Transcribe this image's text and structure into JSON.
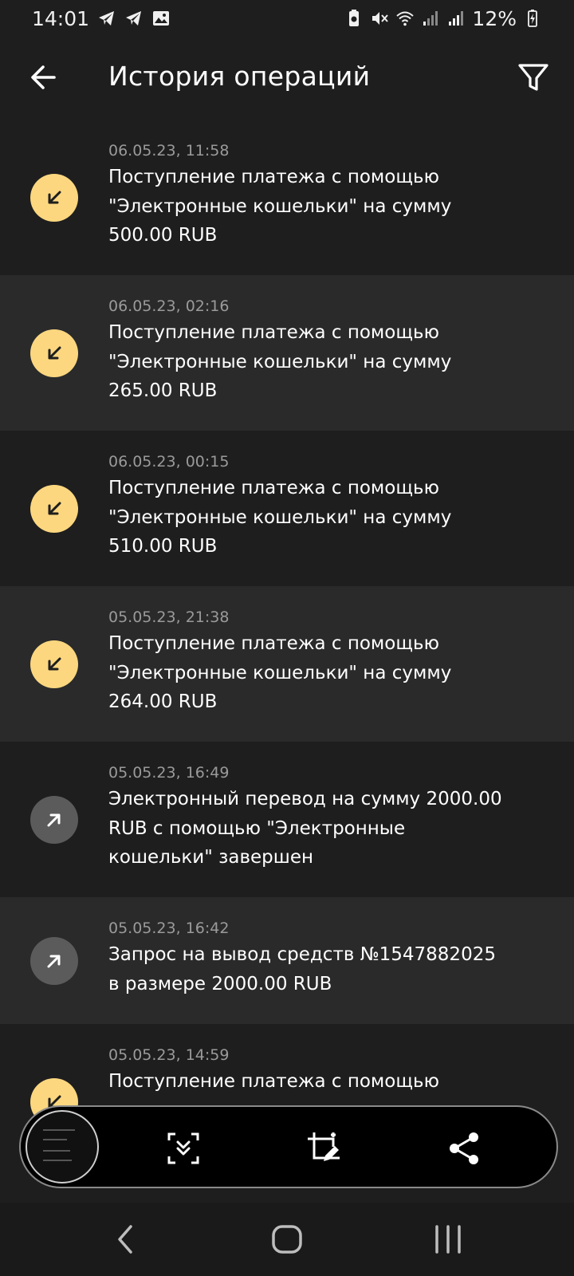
{
  "status_bar": {
    "time": "14:01",
    "battery": "12%",
    "left_icons": [
      "telegram-icon",
      "telegram-icon",
      "gallery-icon"
    ],
    "right_icons": [
      "battery-saver-icon",
      "mute-icon",
      "wifi-icon",
      "signal-icon",
      "signal-icon",
      "battery-charging-icon"
    ]
  },
  "header": {
    "title": "История операций",
    "back_icon": "arrow-left-icon",
    "filter_icon": "filter-icon"
  },
  "colors": {
    "background": "#1e1e1e",
    "row_alt": "#2a2a2a",
    "incoming": "#fcd77f",
    "outgoing": "#5b5b5b",
    "date_text": "#9a9a9a"
  },
  "operations": [
    {
      "date": "06.05.23, 11:58",
      "text": "Поступление платежа с помощью \"Электронные кошельки\" на сумму 500.00 RUB",
      "direction": "incoming"
    },
    {
      "date": "06.05.23, 02:16",
      "text": "Поступление платежа с помощью \"Электронные кошельки\" на сумму 265.00 RUB",
      "direction": "incoming"
    },
    {
      "date": "06.05.23, 00:15",
      "text": "Поступление платежа с помощью \"Электронные кошельки\" на сумму 510.00 RUB",
      "direction": "incoming"
    },
    {
      "date": "05.05.23, 21:38",
      "text": "Поступление платежа с помощью \"Электронные кошельки\" на сумму 264.00 RUB",
      "direction": "incoming"
    },
    {
      "date": "05.05.23, 16:49",
      "text": "Электронный перевод на сумму 2000.00 RUB с помощью \"Электронные кошельки\" завершен",
      "direction": "outgoing"
    },
    {
      "date": "05.05.23, 16:42",
      "text": "Запрос на вывод средств №1547882025 в размере 2000.00 RUB",
      "direction": "outgoing"
    },
    {
      "date": "05.05.23, 14:59",
      "text": "Поступление платежа с помощью",
      "direction": "incoming"
    }
  ],
  "screenshot_toolbar": {
    "icons": [
      "screenshot-thumbnail",
      "scroll-capture-icon",
      "crop-edit-icon",
      "share-icon"
    ]
  },
  "nav_bar": {
    "icons": [
      "nav-back-icon",
      "nav-home-icon",
      "nav-recents-icon"
    ]
  }
}
